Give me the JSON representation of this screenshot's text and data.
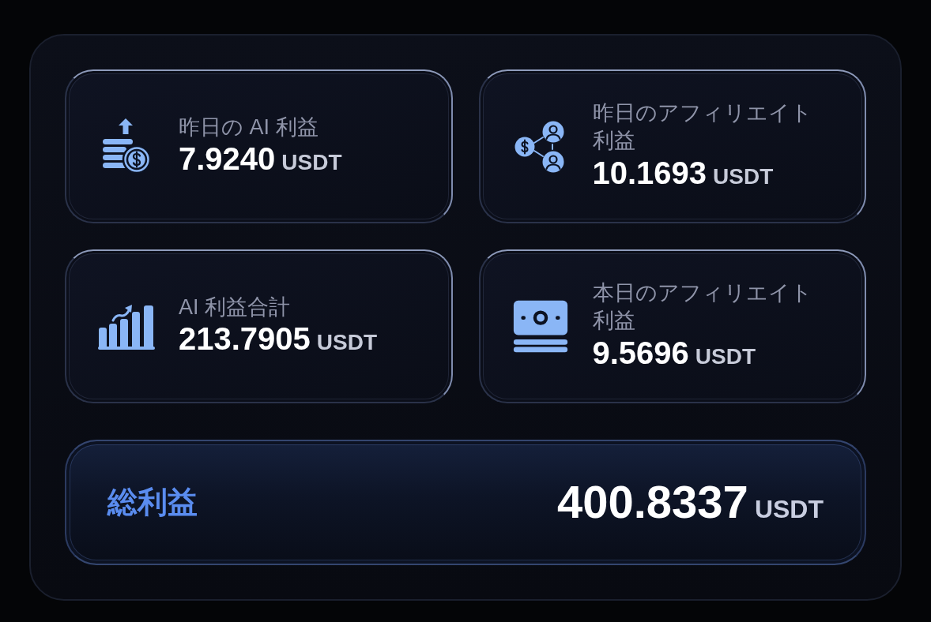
{
  "panel": {
    "cards": [
      {
        "kind": "coins",
        "label": "昨日の AI 利益",
        "value": "7.9240",
        "unit": "USDT"
      },
      {
        "kind": "network",
        "label": "昨日のアフィリエイト利益",
        "value": "10.1693",
        "unit": "USDT"
      },
      {
        "kind": "chart",
        "label": "AI 利益合計",
        "value": "213.7905",
        "unit": "USDT"
      },
      {
        "kind": "banknote",
        "label": "本日のアフィリエイト利益",
        "value": "9.5696",
        "unit": "USDT"
      }
    ],
    "total": {
      "label": "総利益",
      "value": "400.8337",
      "unit": "USDT"
    }
  }
}
